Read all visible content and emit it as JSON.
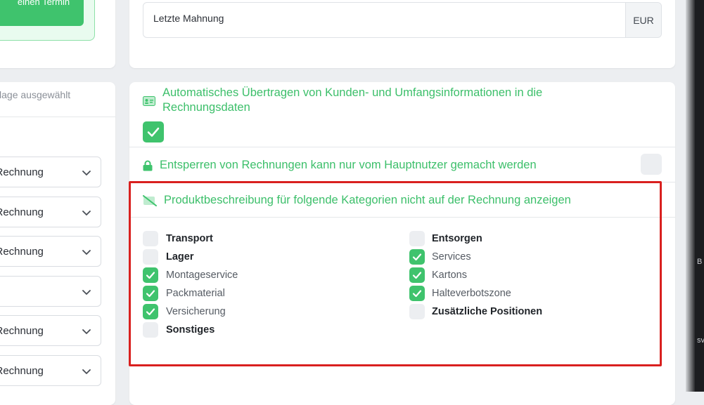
{
  "booking": {
    "button_label": "Buchen Sie einen Termin"
  },
  "templates": {
    "header_text": "Vorlage ausgewählt",
    "selects": [
      {
        "label": "d Rechnung"
      },
      {
        "label": "d Rechnung"
      },
      {
        "label": "d Rechnung"
      },
      {
        "label": ""
      },
      {
        "label": "d Rechnung"
      },
      {
        "label": "d Rechnung"
      }
    ]
  },
  "top_card": {
    "input_value": "Letzte Mahnung",
    "unit": "EUR"
  },
  "settings": {
    "auto_transfer": {
      "title": "Automatisches Übertragen von Kunden- und Umfangsinformationen in die Rechnungsdaten",
      "checked": true
    },
    "unlock": {
      "title": "Entsperren von Rechnungen kann nur vom Hauptnutzer gemacht werden",
      "checked": false
    },
    "hide_descriptions": {
      "title": "Produktbeschreibung für folgende Kategorien nicht auf der Rechnung anzeigen",
      "left_categories": [
        {
          "label": "Transport",
          "checked": false
        },
        {
          "label": "Lager",
          "checked": false
        },
        {
          "label": "Montageservice",
          "checked": true
        },
        {
          "label": "Packmaterial",
          "checked": true
        },
        {
          "label": "Versicherung",
          "checked": true
        },
        {
          "label": "Sonstiges",
          "checked": false
        }
      ],
      "right_categories": [
        {
          "label": "Entsorgen",
          "checked": false
        },
        {
          "label": "Services",
          "checked": true
        },
        {
          "label": "Kartons",
          "checked": true
        },
        {
          "label": "Halteverbotszone",
          "checked": true
        },
        {
          "label": "Zusätzliche Positionen",
          "checked": false
        }
      ]
    }
  },
  "edge": {
    "text_1": "B",
    "text_2": "sv"
  },
  "colors": {
    "accent": "#3fc36d",
    "highlight": "#d9201f"
  }
}
